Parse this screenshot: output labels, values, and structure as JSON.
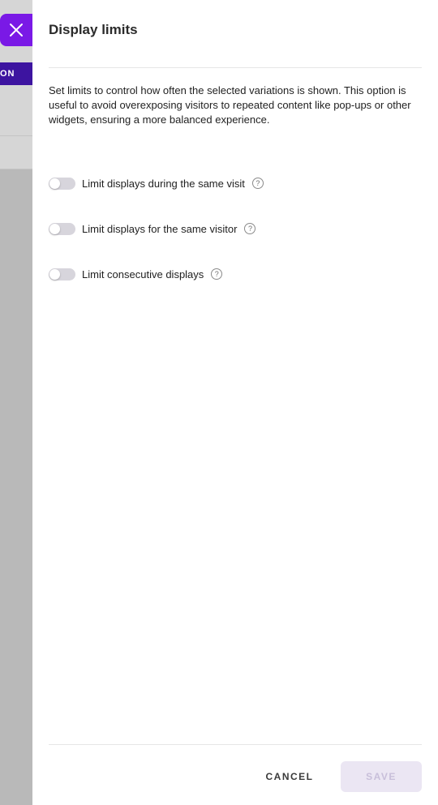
{
  "background": {
    "button_label": "ON"
  },
  "panel": {
    "title": "Display limits",
    "description": "Set limits to control how often the selected variations is shown. This option is useful to avoid overexposing visitors to repeated content like pop-ups or other widgets, ensuring a more balanced experience.",
    "options": [
      {
        "label": "Limit displays during the same visit",
        "enabled": false
      },
      {
        "label": "Limit displays for the same visitor",
        "enabled": false
      },
      {
        "label": "Limit consecutive displays",
        "enabled": false
      }
    ],
    "help_glyph": "?"
  },
  "footer": {
    "cancel_label": "CANCEL",
    "save_label": "SAVE"
  },
  "colors": {
    "accent": "#7a19e6",
    "background_button": "#3d14a0",
    "toggle_off": "#d7d5dc",
    "save_disabled_bg": "#ebe6f3",
    "save_disabled_text": "#c8bfda"
  }
}
